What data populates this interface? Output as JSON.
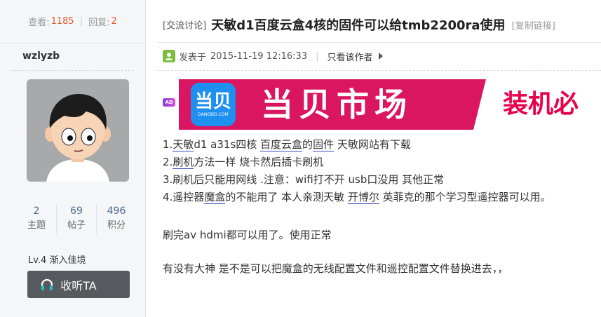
{
  "thread_stats": {
    "views_label": "查看:",
    "views_value": "1185",
    "replies_label": "回复:",
    "replies_value": "2"
  },
  "author": {
    "username": "wzlyzb",
    "stats": [
      {
        "value": "2",
        "label": "主题"
      },
      {
        "value": "69",
        "label": "帖子"
      },
      {
        "value": "496",
        "label": "积分"
      }
    ],
    "level": "Lv.4 渐入佳境",
    "follow_label": "收听TA"
  },
  "post": {
    "category": "[交流讨论]",
    "title": "天敏d1百度云盒4核的固件可以给tmb2200ra使用",
    "copy_link": "[复制链接]",
    "posted_label": "发表于",
    "posted_time": "2015-11-19 12:16:33",
    "only_author": "只看该作者"
  },
  "ad": {
    "tag": "AD",
    "logo_text": "当贝",
    "logo_sub": "DANGBEI.COM",
    "banner_text": "当贝市场",
    "banner_right_text": "装机必"
  },
  "content": {
    "line1": {
      "p1": "1.",
      "k1": "天敏",
      "p2": "d1 a31s四核 ",
      "k2": "百度云盒",
      "p3": "的",
      "k3": "固件",
      "p4": " 天敏网站有下载"
    },
    "line2": {
      "p1": "2.",
      "k1": "刷机",
      "p2": "方法一样 烧卡然后插卡刷机"
    },
    "line3": "3.刷机后只能用网线 .注意：wifi打不开  usb口没用 其他正常",
    "line4": {
      "p1": "4.遥控器",
      "k1": "魔盒",
      "p2": "的不能用了 本人亲测天敏 ",
      "k2": "开博尔",
      "p3": " 英菲克的那个学习型遥控器可以用。"
    },
    "para2": "刷完av  hdmi都可以用了。使用正常",
    "para3": "有没有大神 是不是可以把魔盒的无线配置文件和遥控配置文件替换进去，，"
  },
  "colors": {
    "stat_number": "#e0592b",
    "banner_bg": "#d9165f",
    "button_bg": "#56595d",
    "link_underline": "#3a4ab8"
  }
}
